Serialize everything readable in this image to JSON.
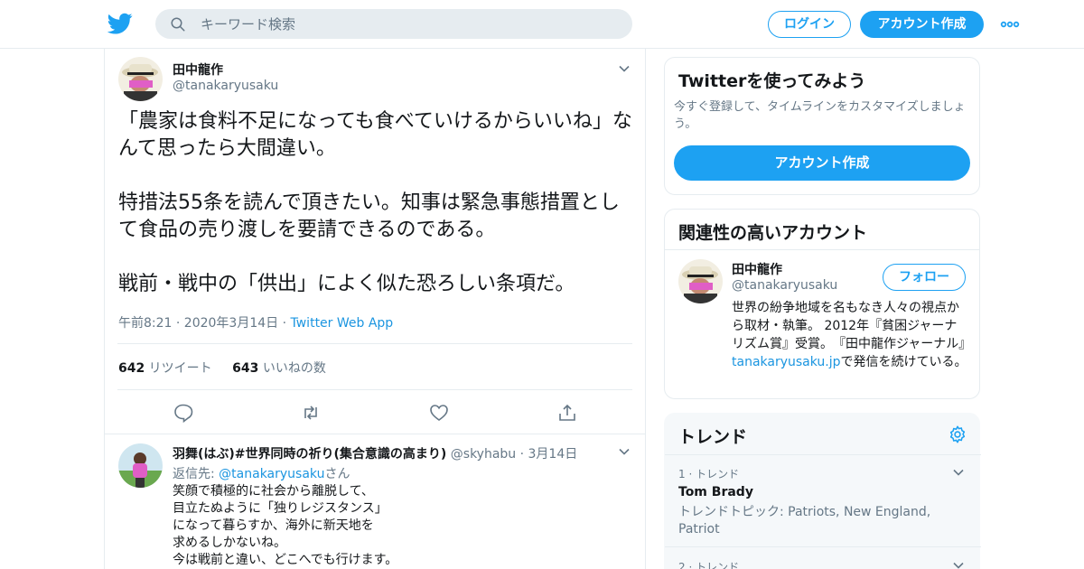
{
  "header": {
    "search_placeholder": "キーワード検索",
    "login_label": "ログイン",
    "signup_label": "アカウント作成"
  },
  "tweet": {
    "name": "田中龍作",
    "handle": "@tanakaryusaku",
    "text": "「農家は食料不足になっても食べていけるからいいね」なんて思ったら大間違い。\n\n特措法55条を読んで頂きたい。知事は緊急事態措置として食品の売り渡しを要請できるのである。\n\n戦前・戦中の「供出」によく似た恐ろしい条項だ。",
    "time": "午前8:21 · 2020年3月14日 · ",
    "source": "Twitter Web App",
    "retweets_count": "642",
    "retweets_label": " リツイート",
    "likes_count": "643",
    "likes_label": " いいねの数"
  },
  "reply": {
    "name": "羽舞(はぶ)#世界同時の祈り(集合意識の高まり)",
    "handle": " @skyhabu · 3月14日",
    "reply_prefix": "返信先: ",
    "reply_to": "@tanakaryusaku",
    "reply_suffix": "さん",
    "text": "笑顔で積極的に社会から離脱して、\n目立たぬように「独りレジスタンス」\nになって暮らすか、海外に新天地を\n求めるしかないね。\n今は戦前と違い、どこへでも行けます。"
  },
  "sidebar": {
    "signup_card": {
      "title": "Twitterを使ってみよう",
      "desc": "今すぐ登録して、タイムラインをカスタマイズしましょう。",
      "button": "アカウント作成"
    },
    "related": {
      "title": "関連性の高いアカウント",
      "name": "田中龍作",
      "handle": "@tanakaryusaku",
      "follow_label": "フォロー",
      "bio_part1": "世界の紛争地域を名もなき人々の視点から取材・執筆。 2012年『貧困ジャーナリズム賞』受賞。　『田中龍作ジャーナル』",
      "bio_link": "tanakaryusaku.jp",
      "bio_part2": "で発信を続けている。"
    },
    "trends": {
      "title": "トレンド",
      "items": [
        {
          "rank": "1 · トレンド",
          "name": "Tom Brady",
          "topic": "トレンドトピック: Patriots, New England, Patriot"
        },
        {
          "rank": "2 · トレンド",
          "name": "",
          "topic": ""
        }
      ]
    }
  },
  "colors": {
    "brand": "#1da1f2",
    "link": "#1b95e0",
    "muted": "#657786",
    "border": "#e6ecf0"
  }
}
